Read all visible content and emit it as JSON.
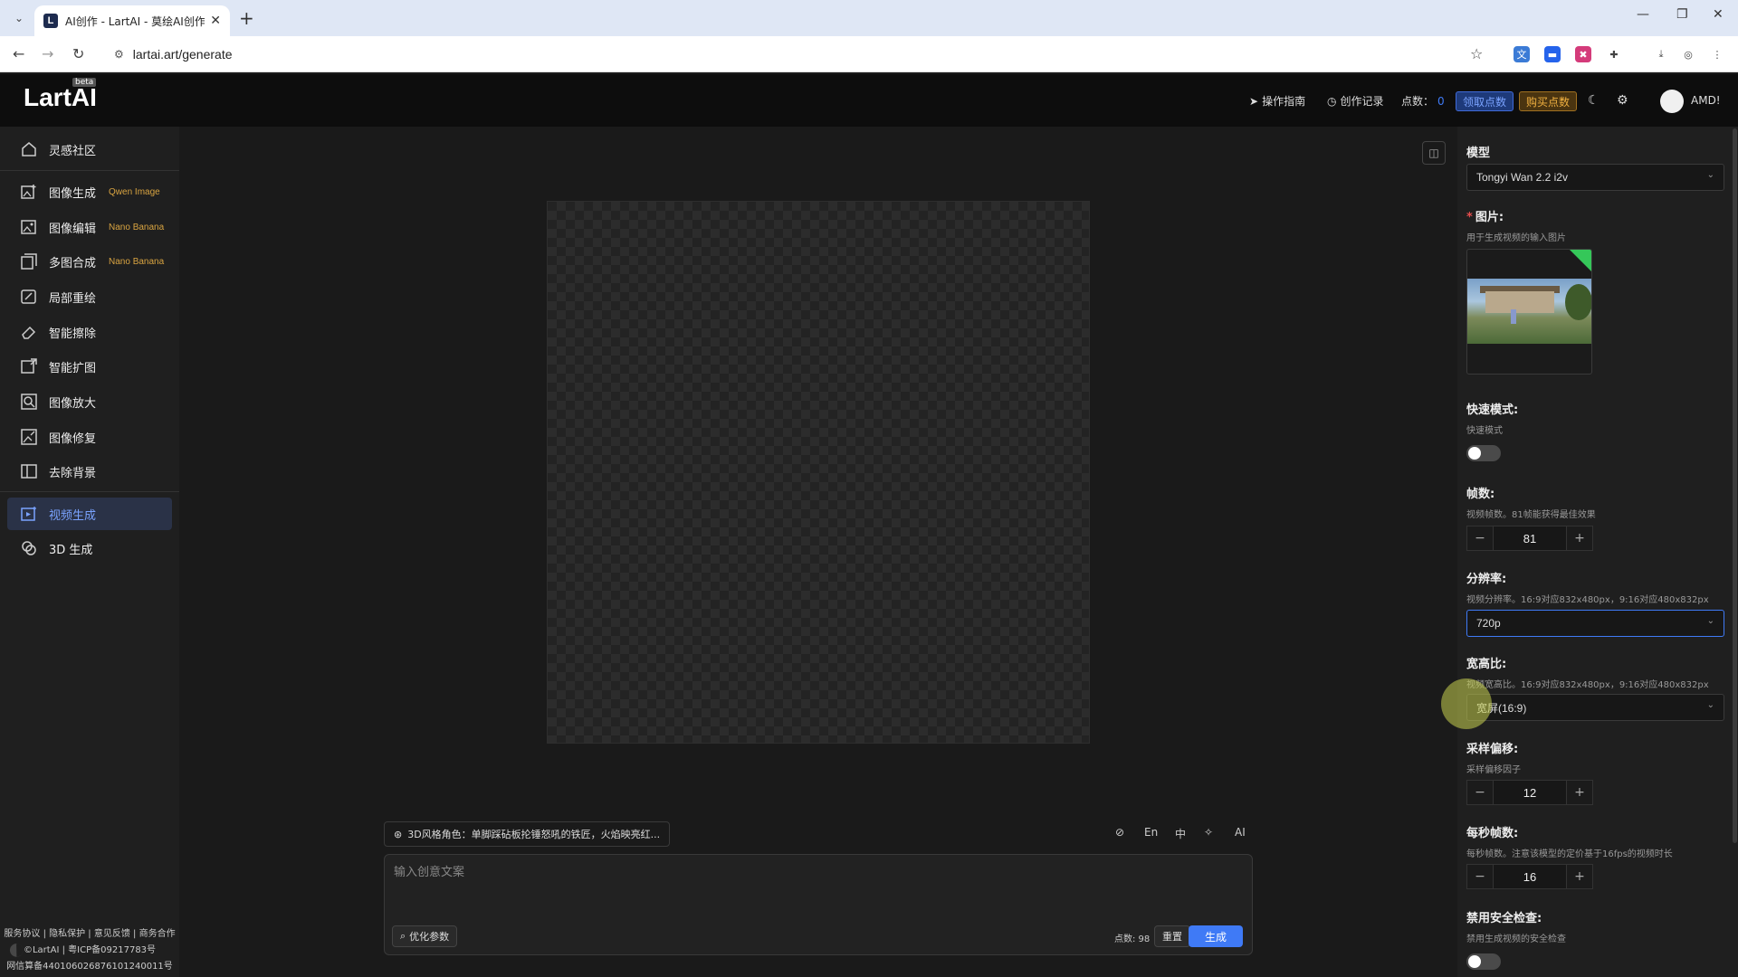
{
  "browser": {
    "tab_title": "AI创作 - LartAI - 莫绘AI创作平",
    "url": "lartai.art/generate",
    "favicon_letter": "L"
  },
  "header": {
    "logo": "LartAI",
    "beta": "beta",
    "guide": "操作指南",
    "history": "创作记录",
    "points_label": "点数：",
    "points_value": "0",
    "claim_points": "领取点数",
    "buy_points": "购买点数",
    "user_name": "AMD!"
  },
  "sidebar": {
    "items": [
      {
        "label": "灵感社区",
        "icon": "home-icon",
        "tag": ""
      },
      {
        "label": "图像生成",
        "icon": "image-add-icon",
        "tag": "Qwen Image"
      },
      {
        "label": "图像编辑",
        "icon": "image-edit-icon",
        "tag": "Nano Banana"
      },
      {
        "label": "多图合成",
        "icon": "layers-icon",
        "tag": "Nano Banana"
      },
      {
        "label": "局部重绘",
        "icon": "brush-icon",
        "tag": ""
      },
      {
        "label": "智能擦除",
        "icon": "eraser-icon",
        "tag": ""
      },
      {
        "label": "智能扩图",
        "icon": "expand-icon",
        "tag": ""
      },
      {
        "label": "图像放大",
        "icon": "zoom-icon",
        "tag": ""
      },
      {
        "label": "图像修复",
        "icon": "repair-icon",
        "tag": ""
      },
      {
        "label": "去除背景",
        "icon": "remove-bg-icon",
        "tag": ""
      },
      {
        "label": "视频生成",
        "icon": "video-icon",
        "tag": ""
      },
      {
        "label": "3D 生成",
        "icon": "cube-icon",
        "tag": ""
      }
    ],
    "footer_line1": "服务协议 | 隐私保护 | 意见反馈 | 商务合作",
    "footer_line2": "©LartAI | 粤ICP备09217783号",
    "footer_line3": "网信算备440106026876101240011号"
  },
  "prompt": {
    "chip_text": "3D风格角色：单脚踩砧板抡锤怒吼的铁匠，火焰映亮红...",
    "tool_en": "En",
    "tool_zh": "中",
    "tool_ai": "AI",
    "placeholder": "输入创意文案",
    "optimize": "优化参数",
    "points_note": "点数: 98",
    "reset": "重置",
    "generate": "生成"
  },
  "panel": {
    "model_label": "模型",
    "model_value": "Tongyi Wan 2.2 i2v",
    "image_label": "图片:",
    "image_sub": "用于生成视频的输入图片",
    "fast_label": "快速模式:",
    "fast_sub": "快速模式",
    "frames_label": "帧数:",
    "frames_sub": "视频帧数。81帧能获得最佳效果",
    "frames_value": "81",
    "res_label": "分辨率:",
    "res_sub": "视频分辨率。16:9对应832x480px，9:16对应480x832px",
    "res_value": "720p",
    "aspect_label": "宽高比:",
    "aspect_sub": "视频宽高比。16:9对应832x480px，9:16对应480x832px",
    "aspect_value": "宽屏(16:9)",
    "shift_label": "采样偏移:",
    "shift_sub": "采样偏移因子",
    "shift_value": "12",
    "fps_label": "每秒帧数:",
    "fps_sub": "每秒帧数。注意该模型的定价基于16fps的视频时长",
    "fps_value": "16",
    "safety_label": "禁用安全检查:",
    "safety_sub": "禁用生成视频的安全检查"
  }
}
